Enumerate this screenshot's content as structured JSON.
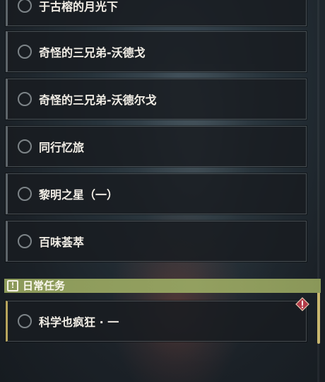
{
  "quests_main": [
    {
      "label": "于古榕的月光下"
    },
    {
      "label": "奇怪的三兄弟-沃德戈"
    },
    {
      "label": "奇怪的三兄弟-沃德尔戈"
    },
    {
      "label": "同行忆旅"
    },
    {
      "label": "黎明之星（一）"
    },
    {
      "label": "百味荟萃"
    }
  ],
  "daily_category": {
    "label": "日常任务",
    "icon": "exclamation-box-icon",
    "color": "#8f9c5c"
  },
  "quests_daily": [
    {
      "label": "科学也疯狂 · 一",
      "icon": "alert-diamond-icon"
    }
  ],
  "colors": {
    "accent": "#b7a55d",
    "alert": "#b23a48",
    "text": "#f2eee6"
  }
}
